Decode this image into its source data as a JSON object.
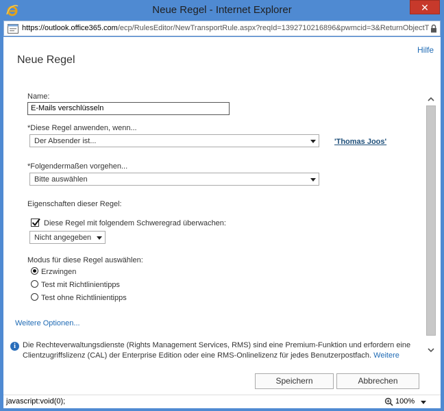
{
  "window": {
    "title": "Neue Regel - Internet Explorer",
    "close_label": "✕"
  },
  "address": {
    "protocol": "https://",
    "host": "outlook.office365.com",
    "path": "/ecp/RulesEditor/NewTransportRule.aspx?reqId=1392710216896&pwmcid=3&ReturnObjectTyp"
  },
  "header": {
    "help": "Hilfe",
    "title": "Neue Regel"
  },
  "form": {
    "name_label": "Name:",
    "name_value": "E-Mails verschlüsseln",
    "condition_label": "*Diese Regel anwenden, wenn...",
    "condition_value": "Der Absender ist...",
    "condition_user": "'Thomas Joos'",
    "action_label": "*Folgendermaßen vorgehen...",
    "action_value": "Bitte auswählen",
    "properties_label": "Eigenschaften dieser Regel:",
    "audit_label": "Diese Regel mit folgendem Schweregrad überwachen:",
    "audit_checked": true,
    "severity_value": "Nicht angegeben",
    "mode_label": "Modus für diese Regel auswählen:",
    "modes": [
      {
        "label": "Erzwingen",
        "selected": true
      },
      {
        "label": "Test mit Richtlinientipps",
        "selected": false
      },
      {
        "label": "Test ohne Richtlinientipps",
        "selected": false
      }
    ],
    "more_options": "Weitere Optionen..."
  },
  "info": {
    "line1": "Die Rechteverwaltungsdienste (Rights Management Services, RMS) sind eine Premium-Funktion und erfordern eine",
    "line2": "Clientzugriffslizenz (CAL) der Enterprise Edition oder eine RMS-Onlinelizenz für jedes Benutzerpostfach.",
    "link": "Weitere"
  },
  "buttons": {
    "save": "Speichern",
    "cancel": "Abbrechen"
  },
  "status": {
    "text": "javascript:void(0);",
    "zoom": "100%"
  }
}
